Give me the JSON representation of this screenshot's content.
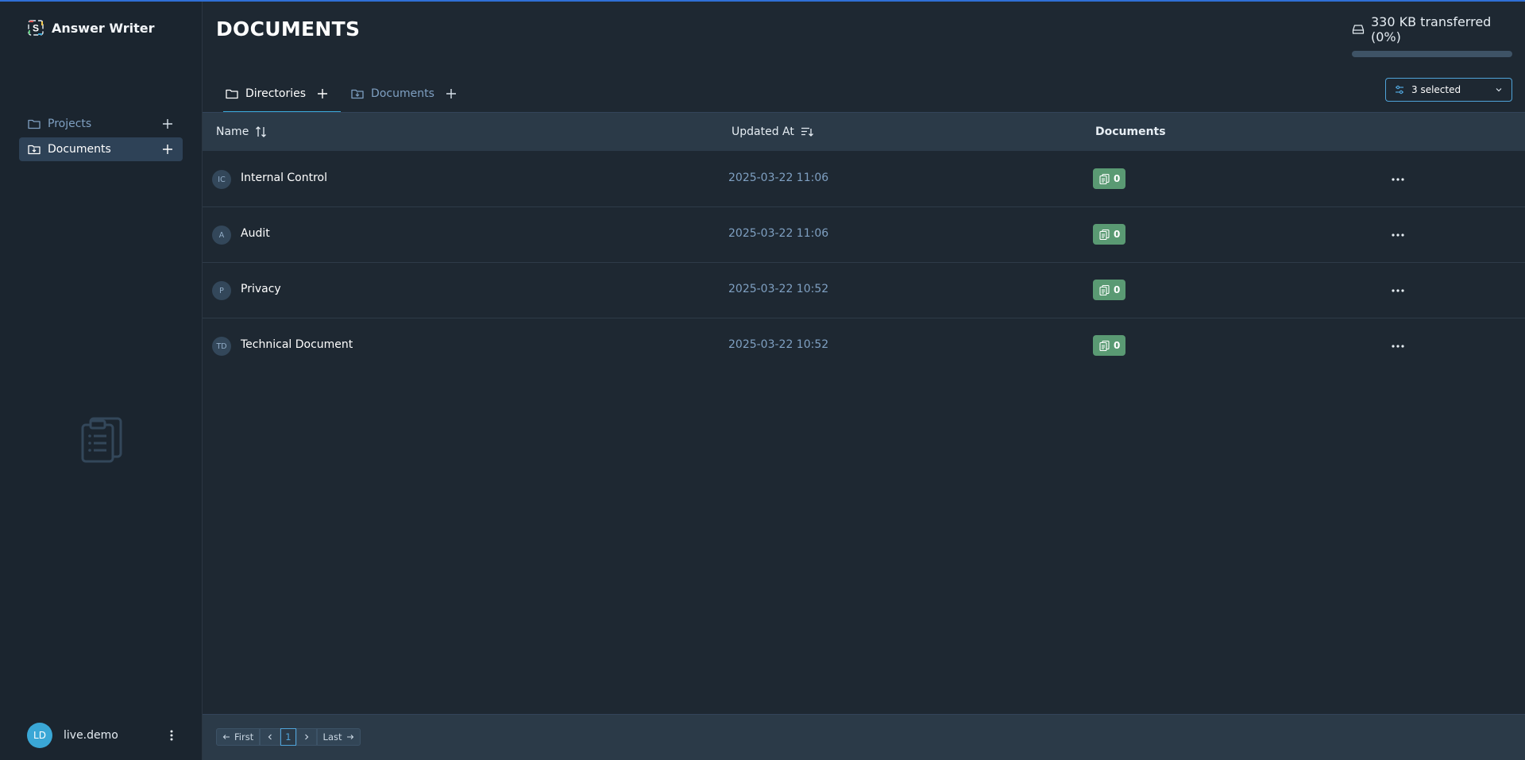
{
  "app": {
    "name": "Answer Writer"
  },
  "sidebar": {
    "items": [
      {
        "label": "Projects",
        "icon": "folder-icon",
        "active": false
      },
      {
        "label": "Documents",
        "icon": "folder-download-icon",
        "active": true
      }
    ],
    "user": {
      "initials": "LD",
      "name": "live.demo"
    }
  },
  "header": {
    "title": "DOCUMENTS",
    "transfer": {
      "text": "330 KB transferred (0%)",
      "progress_percent": 0
    }
  },
  "tabs": [
    {
      "label": "Directories",
      "active": true
    },
    {
      "label": "Documents",
      "active": false
    }
  ],
  "filter": {
    "selected_label": "3 selected"
  },
  "table": {
    "columns": [
      "Name",
      "Updated At",
      "Documents"
    ],
    "rows": [
      {
        "initials": "IC",
        "name": "Internal Control",
        "updated_at": "2025-03-22 11:06",
        "documents": "0"
      },
      {
        "initials": "A",
        "name": "Audit",
        "updated_at": "2025-03-22 11:06",
        "documents": "0"
      },
      {
        "initials": "P",
        "name": "Privacy",
        "updated_at": "2025-03-22 10:52",
        "documents": "0"
      },
      {
        "initials": "TD",
        "name": "Technical Document",
        "updated_at": "2025-03-22 10:52",
        "documents": "0"
      }
    ]
  },
  "pagination": {
    "first_label": "First",
    "current_page": "1",
    "last_label": "Last"
  },
  "colors": {
    "accent": "#3aa7d6",
    "badge": "#5a9a73",
    "background": "#1e2832"
  }
}
